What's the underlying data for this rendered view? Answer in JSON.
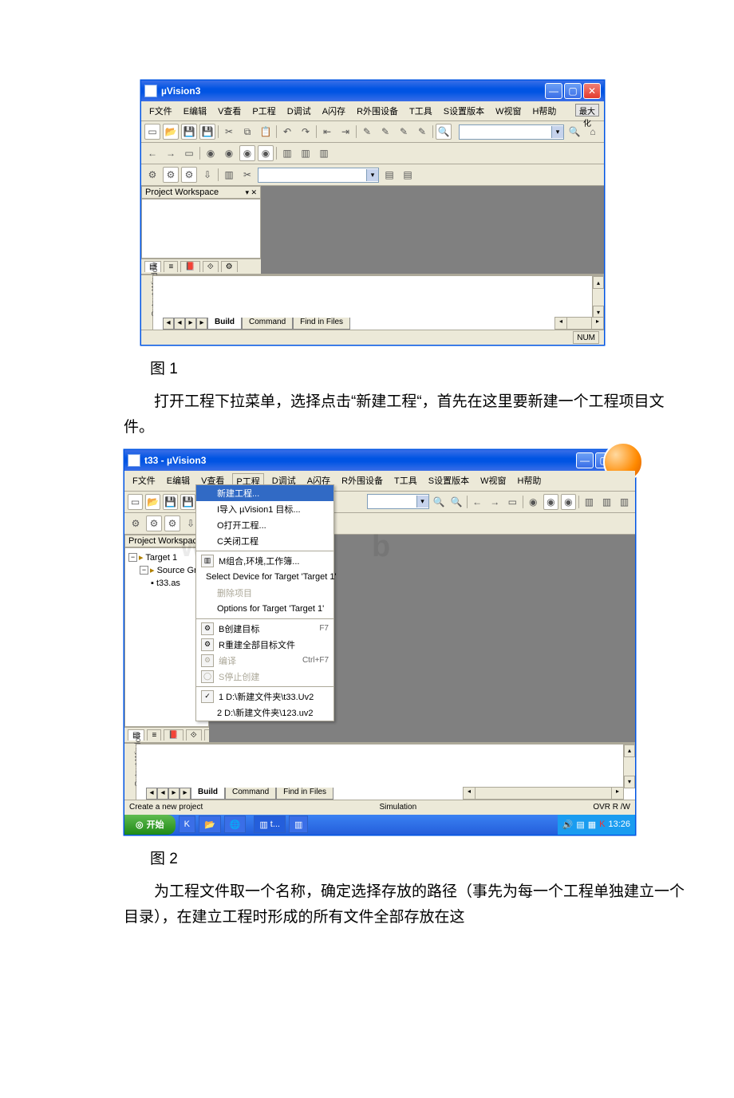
{
  "fig1": {
    "title": "µVision3",
    "menus": [
      "F文件",
      "E编辑",
      "V查看",
      "P工程",
      "D调试",
      "A闪存",
      "R外围设备",
      "T工具",
      "S设置版本",
      "W视窗",
      "H帮助"
    ],
    "max_btn": "最大化",
    "pw_title": "Project Workspace",
    "out_label": "Output Window",
    "out_tabs": [
      "Build",
      "Command",
      "Find in Files"
    ],
    "caption": "图 1",
    "status": "NUM"
  },
  "text1": "打开工程下拉菜单，选择点击“新建工程“，首先在这里要新建一个工程项目文件。",
  "fig2": {
    "title": "t33  -  µVision3",
    "menus": [
      "F文件",
      "E编辑",
      "V查看",
      "P工程",
      "D调试",
      "A闪存",
      "R外围设备",
      "T工具",
      "S设置版本",
      "W视窗",
      "H帮助"
    ],
    "pw_title": "Project Workspace",
    "tree": {
      "target": "Target 1",
      "group": "Source Gro",
      "file": "t33.as"
    },
    "out_label": "Output Window",
    "out_tabs": [
      "Build",
      "Command",
      "Find in Files"
    ],
    "menu": {
      "new": "新建工程...",
      "import": "I导入 µVision1 目标...",
      "open": "O打开工程...",
      "close": "C关闭工程",
      "comp": "M组合,环境,工作簿...",
      "select": "Select Device for Target 'Target 1'",
      "remove": "删除项目",
      "options": "Options for Target 'Target 1'",
      "build": "B创建目标",
      "build_sc": "F7",
      "rebuild": "R重建全部目标文件",
      "trans": "编译",
      "trans_sc": "Ctrl+F7",
      "stop": "S停止创建",
      "recent1": "1 D:\\新建文件夹\\t33.Uv2",
      "recent2": "2 D:\\新建文件夹\\123.uv2"
    },
    "status_left": "Create a new project",
    "status_mid": "Simulation",
    "status_right": "OVR R /W",
    "caption": "图 2"
  },
  "text2": "为工程文件取一个名称，确定选择存放的路径（事先为每一个工程单独建立一个目录），在建立工程时形成的所有文件全部存放在这",
  "taskbar": {
    "start": "开始",
    "tasks": [
      "",
      "",
      " t...",
      "",
      ""
    ],
    "time": "13:26"
  }
}
